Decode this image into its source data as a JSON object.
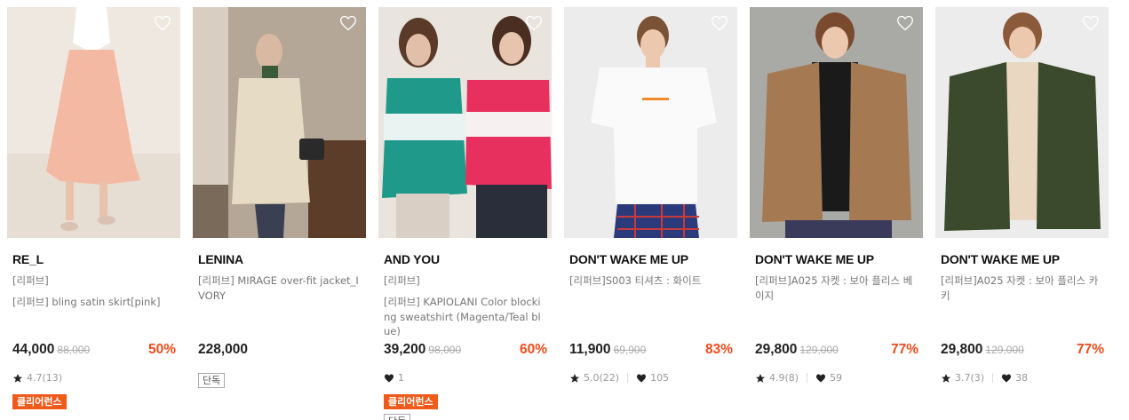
{
  "products": [
    {
      "brand": "RE_L",
      "name_lines": [
        "[리퍼브]",
        "[리퍼브] bling satin skirt[pink]"
      ],
      "price": "44,000",
      "original_price": "88,000",
      "discount": "50%",
      "rating": "4.7(13)",
      "likes": "",
      "badges": [
        "클리어런스"
      ],
      "colors": {
        "bg": "#efe8e1",
        "main": "#f4b9a2"
      }
    },
    {
      "brand": "LENINA",
      "name_lines": [
        "[리퍼브] MIRAGE over-fit jacket_IVORY"
      ],
      "price": "228,000",
      "original_price": "",
      "discount": "",
      "rating": "",
      "likes": "",
      "badges": [
        "단독"
      ],
      "colors": {
        "bg": "#b4a797",
        "main": "#e6dcc6"
      }
    },
    {
      "brand": "AND YOU",
      "name_lines": [
        "[리퍼브]",
        "[리퍼브] KAPIOLANI Color blocking sweatshirt (Magenta/Teal blue)"
      ],
      "price": "39,200",
      "original_price": "98,000",
      "discount": "60%",
      "rating": "",
      "likes": "1",
      "badges": [
        "클리어런스",
        "단독"
      ],
      "colors": {
        "bg": "#e9e4de",
        "main": "#1f9a8a",
        "accent": "#e8305f"
      }
    },
    {
      "brand": "DON'T WAKE ME UP",
      "name_lines": [
        "[리퍼브]S003 티셔츠 : 화이트"
      ],
      "price": "11,900",
      "original_price": "69,900",
      "discount": "83%",
      "rating": "5.0(22)",
      "likes": "105",
      "badges": [],
      "colors": {
        "bg": "#ececec",
        "main": "#fafafa",
        "accent": "#2a3a7a"
      }
    },
    {
      "brand": "DON'T WAKE ME UP",
      "name_lines": [
        "[리퍼브]A025 자켓 : 보아 플리스 베이지"
      ],
      "price": "29,800",
      "original_price": "129,000",
      "discount": "77%",
      "rating": "4.9(8)",
      "likes": "59",
      "badges": [],
      "colors": {
        "bg": "#a9a9a6",
        "main": "#a57a52"
      }
    },
    {
      "brand": "DON'T WAKE ME UP",
      "name_lines": [
        "[리퍼브]A025 자켓 : 보아 플리스 카키"
      ],
      "price": "29,800",
      "original_price": "129,000",
      "discount": "77%",
      "rating": "3.7(3)",
      "likes": "38",
      "badges": [],
      "colors": {
        "bg": "#ececec",
        "main": "#3b4a2c"
      }
    }
  ],
  "icons": {
    "wishlist": "heart-outline-icon",
    "rating": "star-icon",
    "likes": "heart-icon"
  }
}
